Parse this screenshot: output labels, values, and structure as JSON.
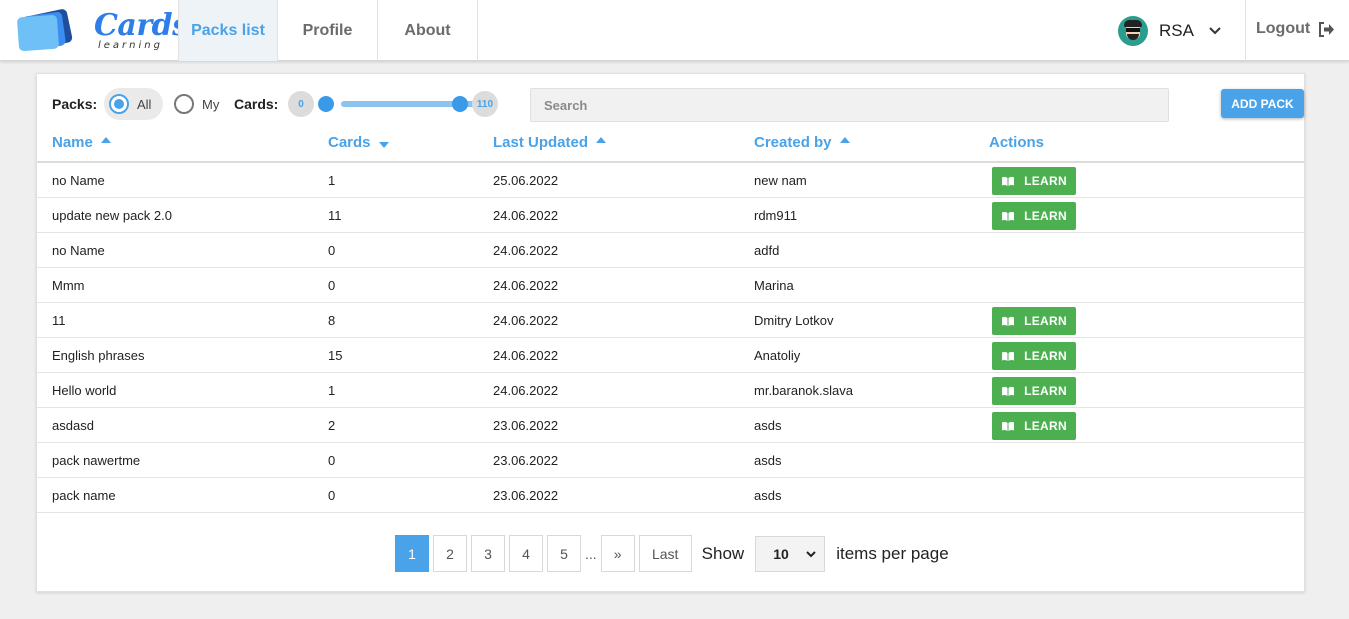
{
  "app": {
    "logo_text": "Cards",
    "logo_subtext": "learning",
    "brand_color": "#2d7ee8",
    "accent_color": "#4aa3e8",
    "learn_color": "#4caf50"
  },
  "nav": {
    "items": [
      {
        "label": "Packs list",
        "active": true
      },
      {
        "label": "Profile",
        "active": false
      },
      {
        "label": "About",
        "active": false
      }
    ]
  },
  "user": {
    "name": "RSA",
    "logout_label": "Logout"
  },
  "filters": {
    "packs_label": "Packs:",
    "all_label": "All",
    "my_label": "My",
    "selected": "All",
    "cards_label": "Cards:",
    "cards_min": "0",
    "cards_max": "110",
    "search_placeholder": "Search",
    "add_pack_label": "ADD PACK"
  },
  "table": {
    "columns": [
      {
        "label": "Name",
        "sort": "up"
      },
      {
        "label": "Cards",
        "sort": "down"
      },
      {
        "label": "Last Updated",
        "sort": "up"
      },
      {
        "label": "Created by",
        "sort": "up"
      },
      {
        "label": "Actions",
        "sort": null
      }
    ],
    "learn_label": "LEARN",
    "rows": [
      {
        "name": "no Name",
        "cards": "1",
        "updated": "25.06.2022",
        "created_by": "new nam",
        "learn": true
      },
      {
        "name": "update new pack 2.0",
        "cards": "11",
        "updated": "24.06.2022",
        "created_by": "rdm911",
        "learn": true
      },
      {
        "name": "no Name",
        "cards": "0",
        "updated": "24.06.2022",
        "created_by": "adfd",
        "learn": false
      },
      {
        "name": "Mmm",
        "cards": "0",
        "updated": "24.06.2022",
        "created_by": "Marina",
        "learn": false
      },
      {
        "name": "11",
        "cards": "8",
        "updated": "24.06.2022",
        "created_by": "Dmitry Lotkov",
        "learn": true
      },
      {
        "name": "English phrases",
        "cards": "15",
        "updated": "24.06.2022",
        "created_by": "Anatoliy",
        "learn": true
      },
      {
        "name": "Hello world",
        "cards": "1",
        "updated": "24.06.2022",
        "created_by": "mr.baranok.slava",
        "learn": true
      },
      {
        "name": "asdasd",
        "cards": "2",
        "updated": "23.06.2022",
        "created_by": "asds",
        "learn": true
      },
      {
        "name": "pack nawertme",
        "cards": "0",
        "updated": "23.06.2022",
        "created_by": "asds",
        "learn": false
      },
      {
        "name": "pack name",
        "cards": "0",
        "updated": "23.06.2022",
        "created_by": "asds",
        "learn": false
      }
    ]
  },
  "pagination": {
    "pages": [
      "1",
      "2",
      "3",
      "4",
      "5"
    ],
    "current": "1",
    "dots": "...",
    "next": "»",
    "last": "Last",
    "show_label": "Show",
    "per_page": "10",
    "per_page_label": "items per page"
  }
}
